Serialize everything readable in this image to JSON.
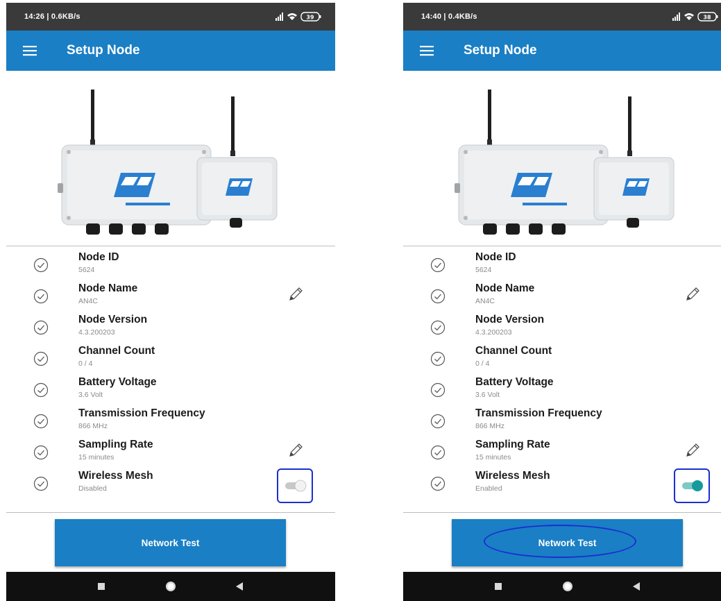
{
  "app": {
    "title": "Setup Node",
    "accent_color": "#1a7fc5",
    "highlight_color": "#1a2fd0"
  },
  "screens": [
    {
      "status_bar": {
        "time_speed": "14:26 | 0.6KB/s",
        "battery": "39"
      },
      "rows": [
        {
          "label": "Node ID",
          "value": "5624",
          "editable": false
        },
        {
          "label": "Node Name",
          "value": "AN4C",
          "editable": true
        },
        {
          "label": "Node Version",
          "value": "4.3.200203",
          "editable": false
        },
        {
          "label": "Channel Count",
          "value": "0 / 4",
          "editable": false
        },
        {
          "label": "Battery Voltage",
          "value": "3.6 Volt",
          "editable": false
        },
        {
          "label": "Transmission Frequency",
          "value": "866 MHz",
          "editable": false
        },
        {
          "label": "Sampling Rate",
          "value": "15 minutes",
          "editable": true
        },
        {
          "label": "Wireless Mesh",
          "value": "Disabled",
          "toggle": false
        }
      ],
      "network_test_label": "Network Test"
    },
    {
      "status_bar": {
        "time_speed": "14:40 | 0.4KB/s",
        "battery": "38"
      },
      "rows": [
        {
          "label": "Node ID",
          "value": "5624",
          "editable": false
        },
        {
          "label": "Node Name",
          "value": "AN4C",
          "editable": true
        },
        {
          "label": "Node Version",
          "value": "4.3.200203",
          "editable": false
        },
        {
          "label": "Channel Count",
          "value": "0 / 4",
          "editable": false
        },
        {
          "label": "Battery Voltage",
          "value": "3.6 Volt",
          "editable": false
        },
        {
          "label": "Transmission Frequency",
          "value": "866 MHz",
          "editable": false
        },
        {
          "label": "Sampling Rate",
          "value": "15 minutes",
          "editable": true
        },
        {
          "label": "Wireless Mesh",
          "value": "Enabled",
          "toggle": true
        }
      ],
      "network_test_label": "Network Test"
    }
  ],
  "icons": {
    "menu": "hamburger-menu-icon",
    "check": "check-circle-icon",
    "edit": "pencil-icon",
    "toggle": "toggle-switch",
    "nav": [
      "recents-square-icon",
      "home-circle-icon",
      "back-triangle-icon"
    ]
  }
}
